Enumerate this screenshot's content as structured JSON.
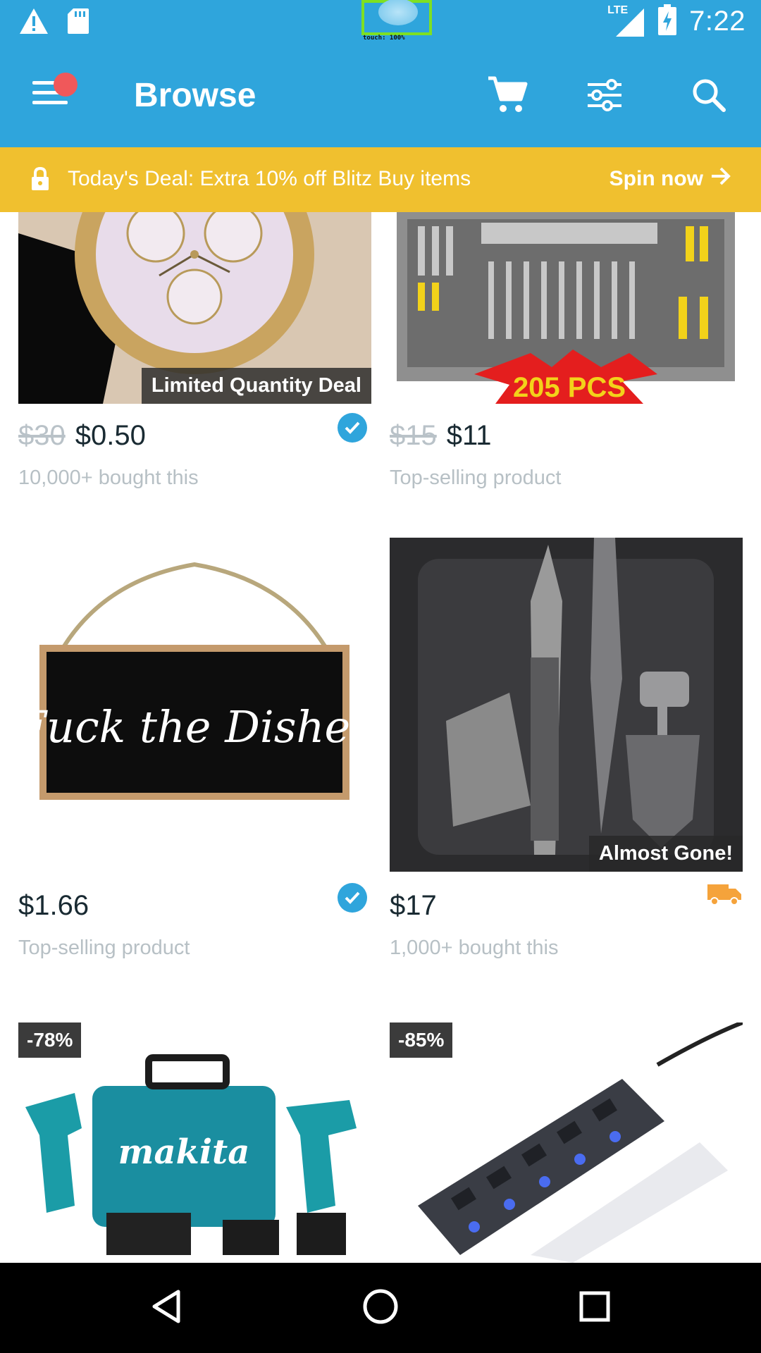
{
  "status_bar": {
    "time": "7:22",
    "network": "LTE",
    "touch_label": "touch: 100%",
    "icons": [
      "warning-icon",
      "sd-card-icon",
      "signal-icon",
      "battery-charging-icon"
    ]
  },
  "app_bar": {
    "title": "Browse",
    "icons": [
      "menu-icon",
      "cart-icon",
      "filter-icon",
      "search-icon"
    ],
    "notification_dot_color": "#f0585a"
  },
  "deal_banner": {
    "text": "Today's Deal: Extra 10% off Blitz Buy items",
    "cta": "Spin now",
    "icons": [
      "lock-icon",
      "arrow-right-icon"
    ],
    "color": "#f0c02f"
  },
  "products": [
    {
      "image": "crystal wristwatch",
      "tag": "Limited Quantity Deal",
      "old_price": "$30",
      "price": "$0.50",
      "sub": "10,000+ bought this",
      "badge_icon": "verified-icon"
    },
    {
      "image": "tool set case",
      "image_text": "205 PCS",
      "old_price": "$15",
      "price": "$11",
      "sub": "Top-selling product"
    },
    {
      "image": "hanging wooden sign",
      "image_text": "Fuck the Dishes",
      "price": "$1.66",
      "sub": "Top-selling product",
      "badge_icon": "verified-icon"
    },
    {
      "image": "knife set in case",
      "tag": "Almost Gone!",
      "price": "$17",
      "sub": "1,000+ bought this",
      "badge_icon": "truck-icon"
    },
    {
      "image": "power tool kit",
      "image_text": "makita",
      "discount": "-78%"
    },
    {
      "image": "usb hub",
      "discount": "-85%"
    }
  ],
  "nav_bar": {
    "icons": [
      "back-icon",
      "home-icon",
      "recents-icon"
    ]
  },
  "colors": {
    "primary": "#2fa5dc",
    "banner": "#f0c02f",
    "price_text": "#192a32",
    "muted_text": "#b7c0c5"
  }
}
